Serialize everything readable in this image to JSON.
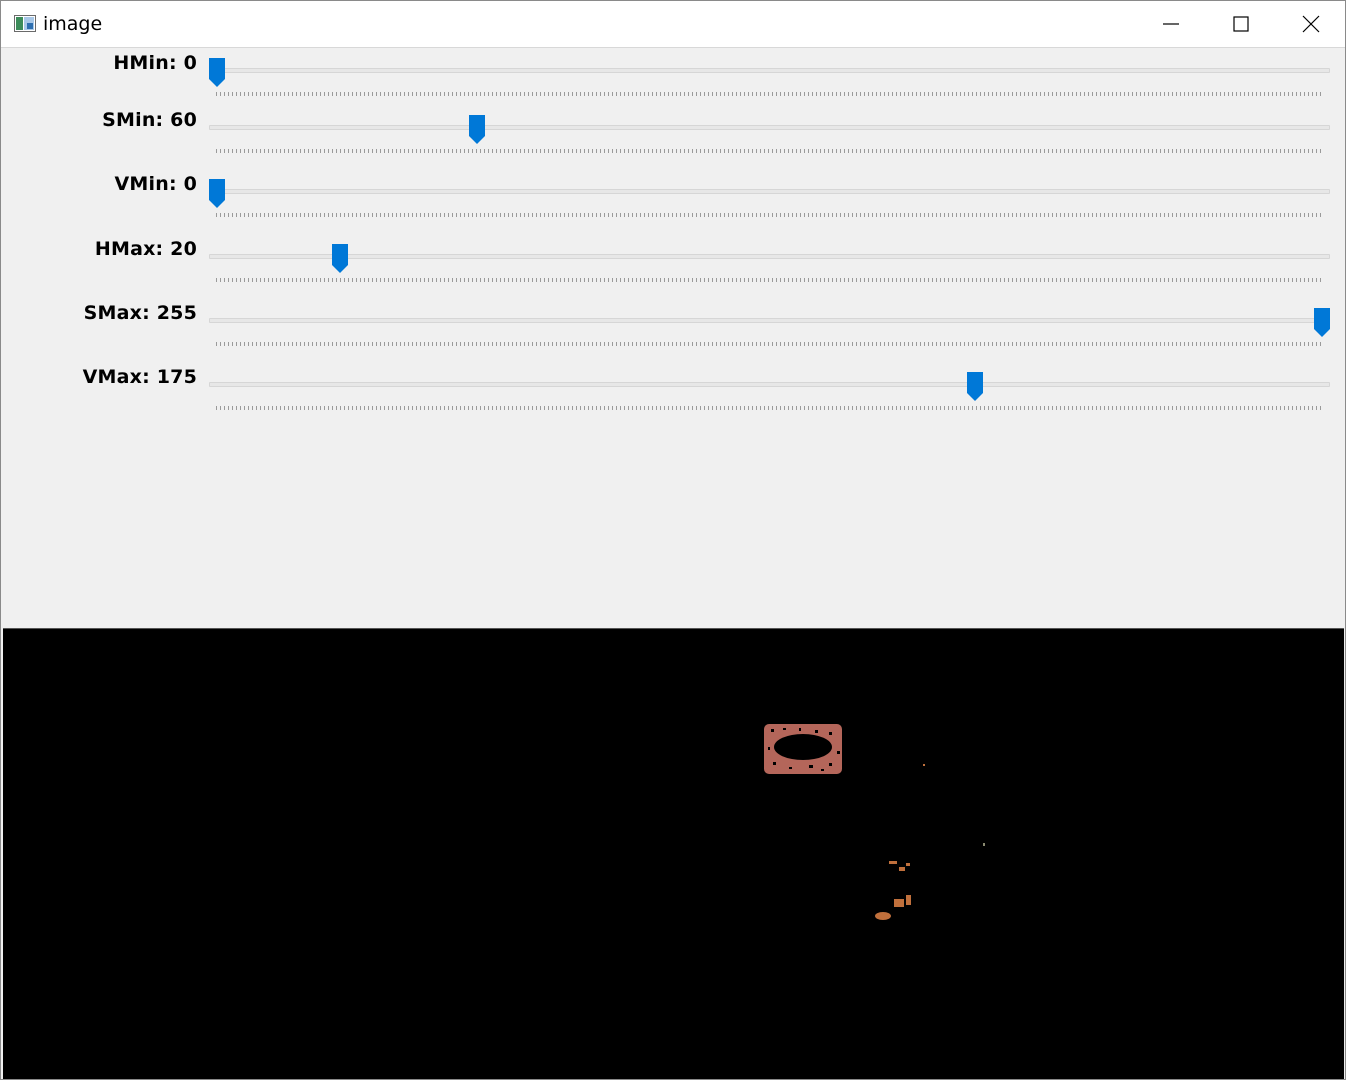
{
  "window": {
    "title": "image",
    "minimize_icon": "minimize-icon",
    "maximize_icon": "maximize-icon",
    "close_icon": "close-icon"
  },
  "accent_color": "#0078d7",
  "trackbars": [
    {
      "label": "HMin: 0",
      "value": 0,
      "max": 179
    },
    {
      "label": "SMin: 60",
      "value": 60,
      "max": 255
    },
    {
      "label": "VMin: 0",
      "value": 0,
      "max": 255
    },
    {
      "label": "HMax: 20",
      "value": 20,
      "max": 179
    },
    {
      "label": "SMax: 255",
      "value": 255,
      "max": 255
    },
    {
      "label": "VMax: 175",
      "value": 175,
      "max": 255
    }
  ]
}
